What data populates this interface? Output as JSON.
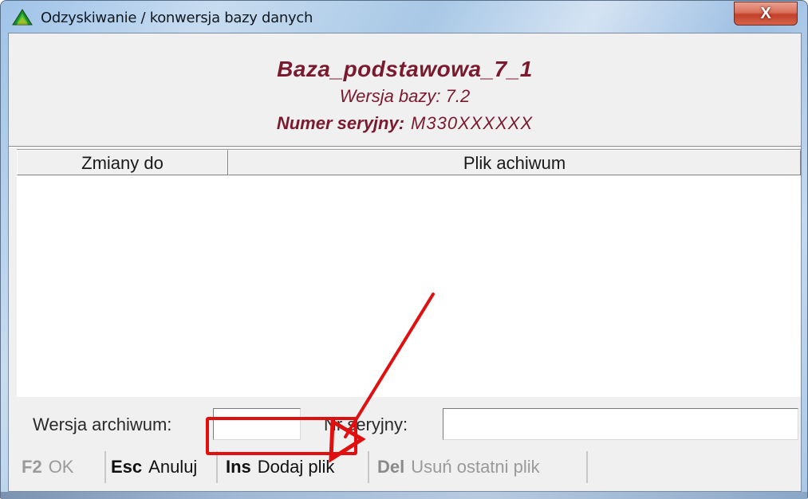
{
  "window": {
    "title": "Odzyskiwanie / konwersja bazy danych",
    "close_label": "X"
  },
  "database": {
    "name": "Baza_podstawowa_7_1",
    "version_label": "Wersja bazy: 7.2",
    "serial_label": "Numer seryjny:",
    "serial_value": "M330XXXXXX"
  },
  "table": {
    "columns": [
      "Zmiany do",
      "Plik achiwum"
    ],
    "rows": []
  },
  "fields": {
    "archive_version_label": "Wersja archiwum:",
    "archive_version_value": "",
    "serial_label": "Nr seryjny:",
    "serial_value": ""
  },
  "keybar": {
    "f2": {
      "key": "F2",
      "label": "OK"
    },
    "esc": {
      "key": "Esc",
      "label": "Anuluj"
    },
    "ins": {
      "key": "Ins",
      "label": "Dodaj plik"
    },
    "del": {
      "key": "Del",
      "label": "Usuń ostatni plik"
    }
  },
  "annotation": {
    "color": "#e01010"
  }
}
